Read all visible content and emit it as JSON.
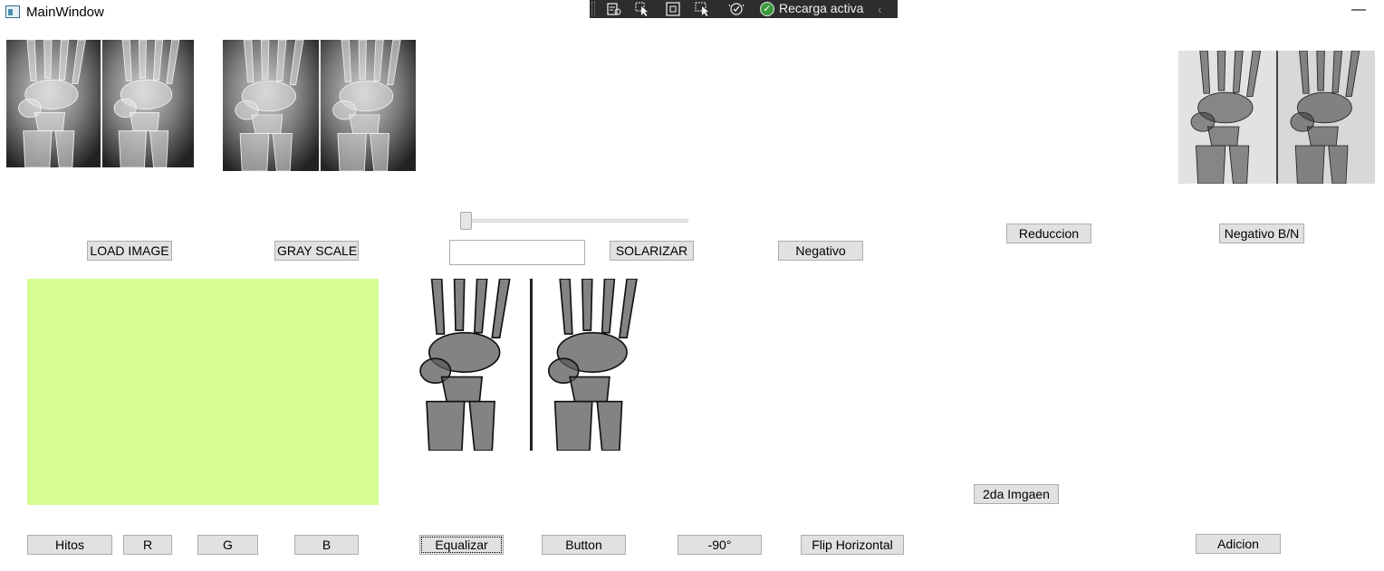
{
  "window": {
    "title": "MainWindow",
    "minimize_glyph": "—"
  },
  "debug_toolbar": {
    "reload_label": "Recarga activa",
    "check_glyph": "✓",
    "collapse_glyph": "‹",
    "icons": [
      "live-visual-tree-icon",
      "select-element-icon",
      "display-layout-adorners-icon",
      "track-focus-icon",
      "hot-reload-settings-icon"
    ]
  },
  "colors": {
    "canvas": "#d5fd92",
    "button_bg": "#e1e1e1",
    "button_border": "#adadad",
    "toolbar_bg": "#2d2d30"
  },
  "buttons": {
    "load_image": "LOAD IMAGE",
    "gray_scale": "GRAY SCALE",
    "solarizar": "SOLARIZAR",
    "negativo": "Negativo",
    "reduccion": "Reduccion",
    "negativo_bn": "Negativo B/N",
    "segunda_imagen": "2da Imgaen",
    "hitos": "Hitos",
    "r": "R",
    "g": "G",
    "b": "B",
    "equalizar": "Equalizar",
    "button": "Button",
    "rotate": "-90°",
    "flip_horizontal": "Flip Horizontal",
    "adicion": "Adicion"
  },
  "solarize_input": {
    "value": ""
  },
  "slider": {
    "value": 0
  }
}
